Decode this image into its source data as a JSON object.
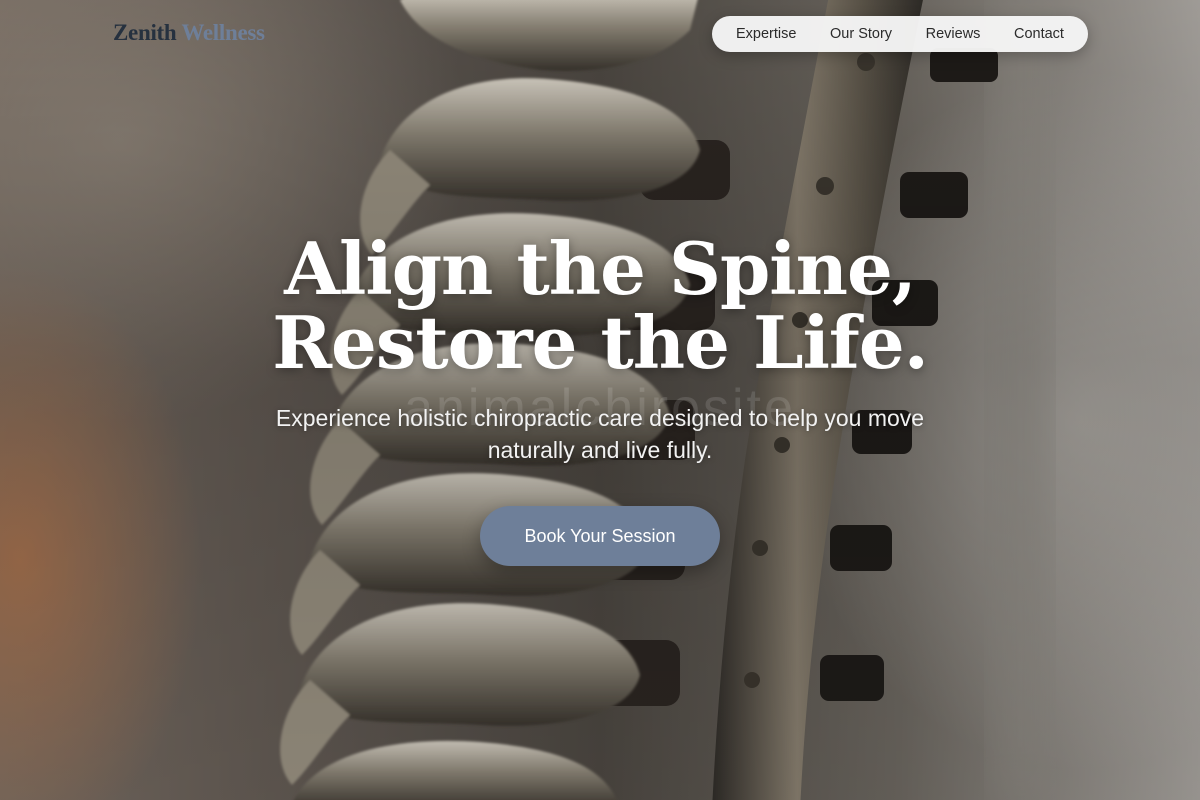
{
  "brand": {
    "part1": "Zenith",
    "part2": "Wellness"
  },
  "nav": {
    "items": [
      "Expertise",
      "Our Story",
      "Reviews",
      "Contact"
    ]
  },
  "hero": {
    "title_line1": "Align the Spine,",
    "title_line2": "Restore the Life.",
    "watermark": "animalchirosite",
    "subtitle": "Experience holistic chiropractic care designed to help you move naturally and live fully.",
    "cta_label": "Book Your Session",
    "background_image": "spine-model-photo"
  },
  "colors": {
    "brand_dark": "#26313f",
    "accent": "#6e7f99",
    "nav_bg": "#f6f6f6"
  }
}
